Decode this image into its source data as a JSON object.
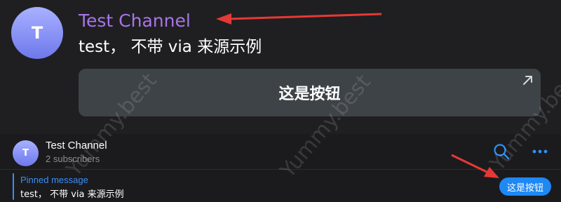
{
  "message": {
    "avatar_initial": "T",
    "sender": "Test Channel",
    "text": "test， 不带 via 来源示例",
    "button": {
      "label": "这是按钮",
      "icon": "arrow-up-right-icon"
    }
  },
  "channel": {
    "avatar_initial": "T",
    "title": "Test Channel",
    "subtitle": "2 subscribers",
    "actions": {
      "search_icon": "search-icon",
      "more_icon": "more-dots-icon"
    }
  },
  "pinned": {
    "title": "Pinned message",
    "text": "test， 不带 via 来源示例",
    "action_label": "这是按钮"
  },
  "watermark": {
    "text": "Yummy.best"
  },
  "colors": {
    "sender_name": "#a974e8",
    "accent_blue": "#1e88f5",
    "annotation_arrow": "#e53935",
    "avatar_gradient": [
      "#a8b1ff",
      "#6e78ec"
    ]
  }
}
